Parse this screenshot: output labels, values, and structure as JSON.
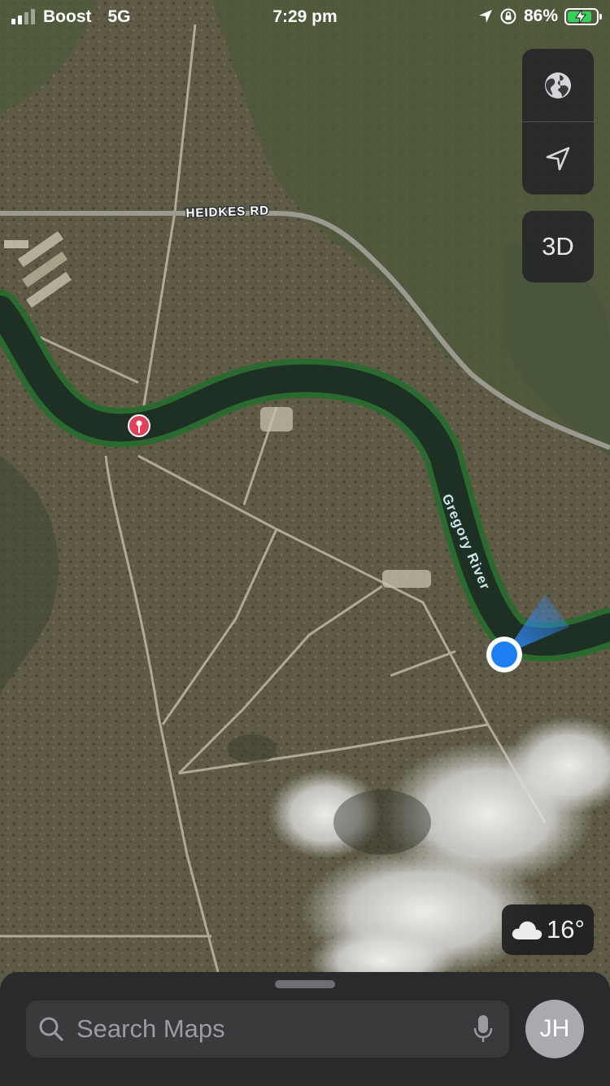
{
  "status_bar": {
    "carrier": "Boost",
    "network": "5G",
    "time": "7:29 pm",
    "battery_percent": "86%",
    "battery_level": 0.86,
    "battery_color": "#35d05c"
  },
  "map": {
    "road_label": "HEIDKES RD",
    "river_label": "Gregory River",
    "pin_color": "#e0425a",
    "location_color": "#1c7ef0"
  },
  "controls": {
    "map_type_icon": "globe-icon",
    "locate_icon": "location-arrow-icon",
    "three_d_label": "3D"
  },
  "weather": {
    "icon": "cloud-icon",
    "temperature": "16°"
  },
  "search": {
    "placeholder": "Search Maps",
    "search_icon": "magnifier-icon",
    "mic_icon": "microphone-icon"
  },
  "account": {
    "initials": "JH"
  }
}
